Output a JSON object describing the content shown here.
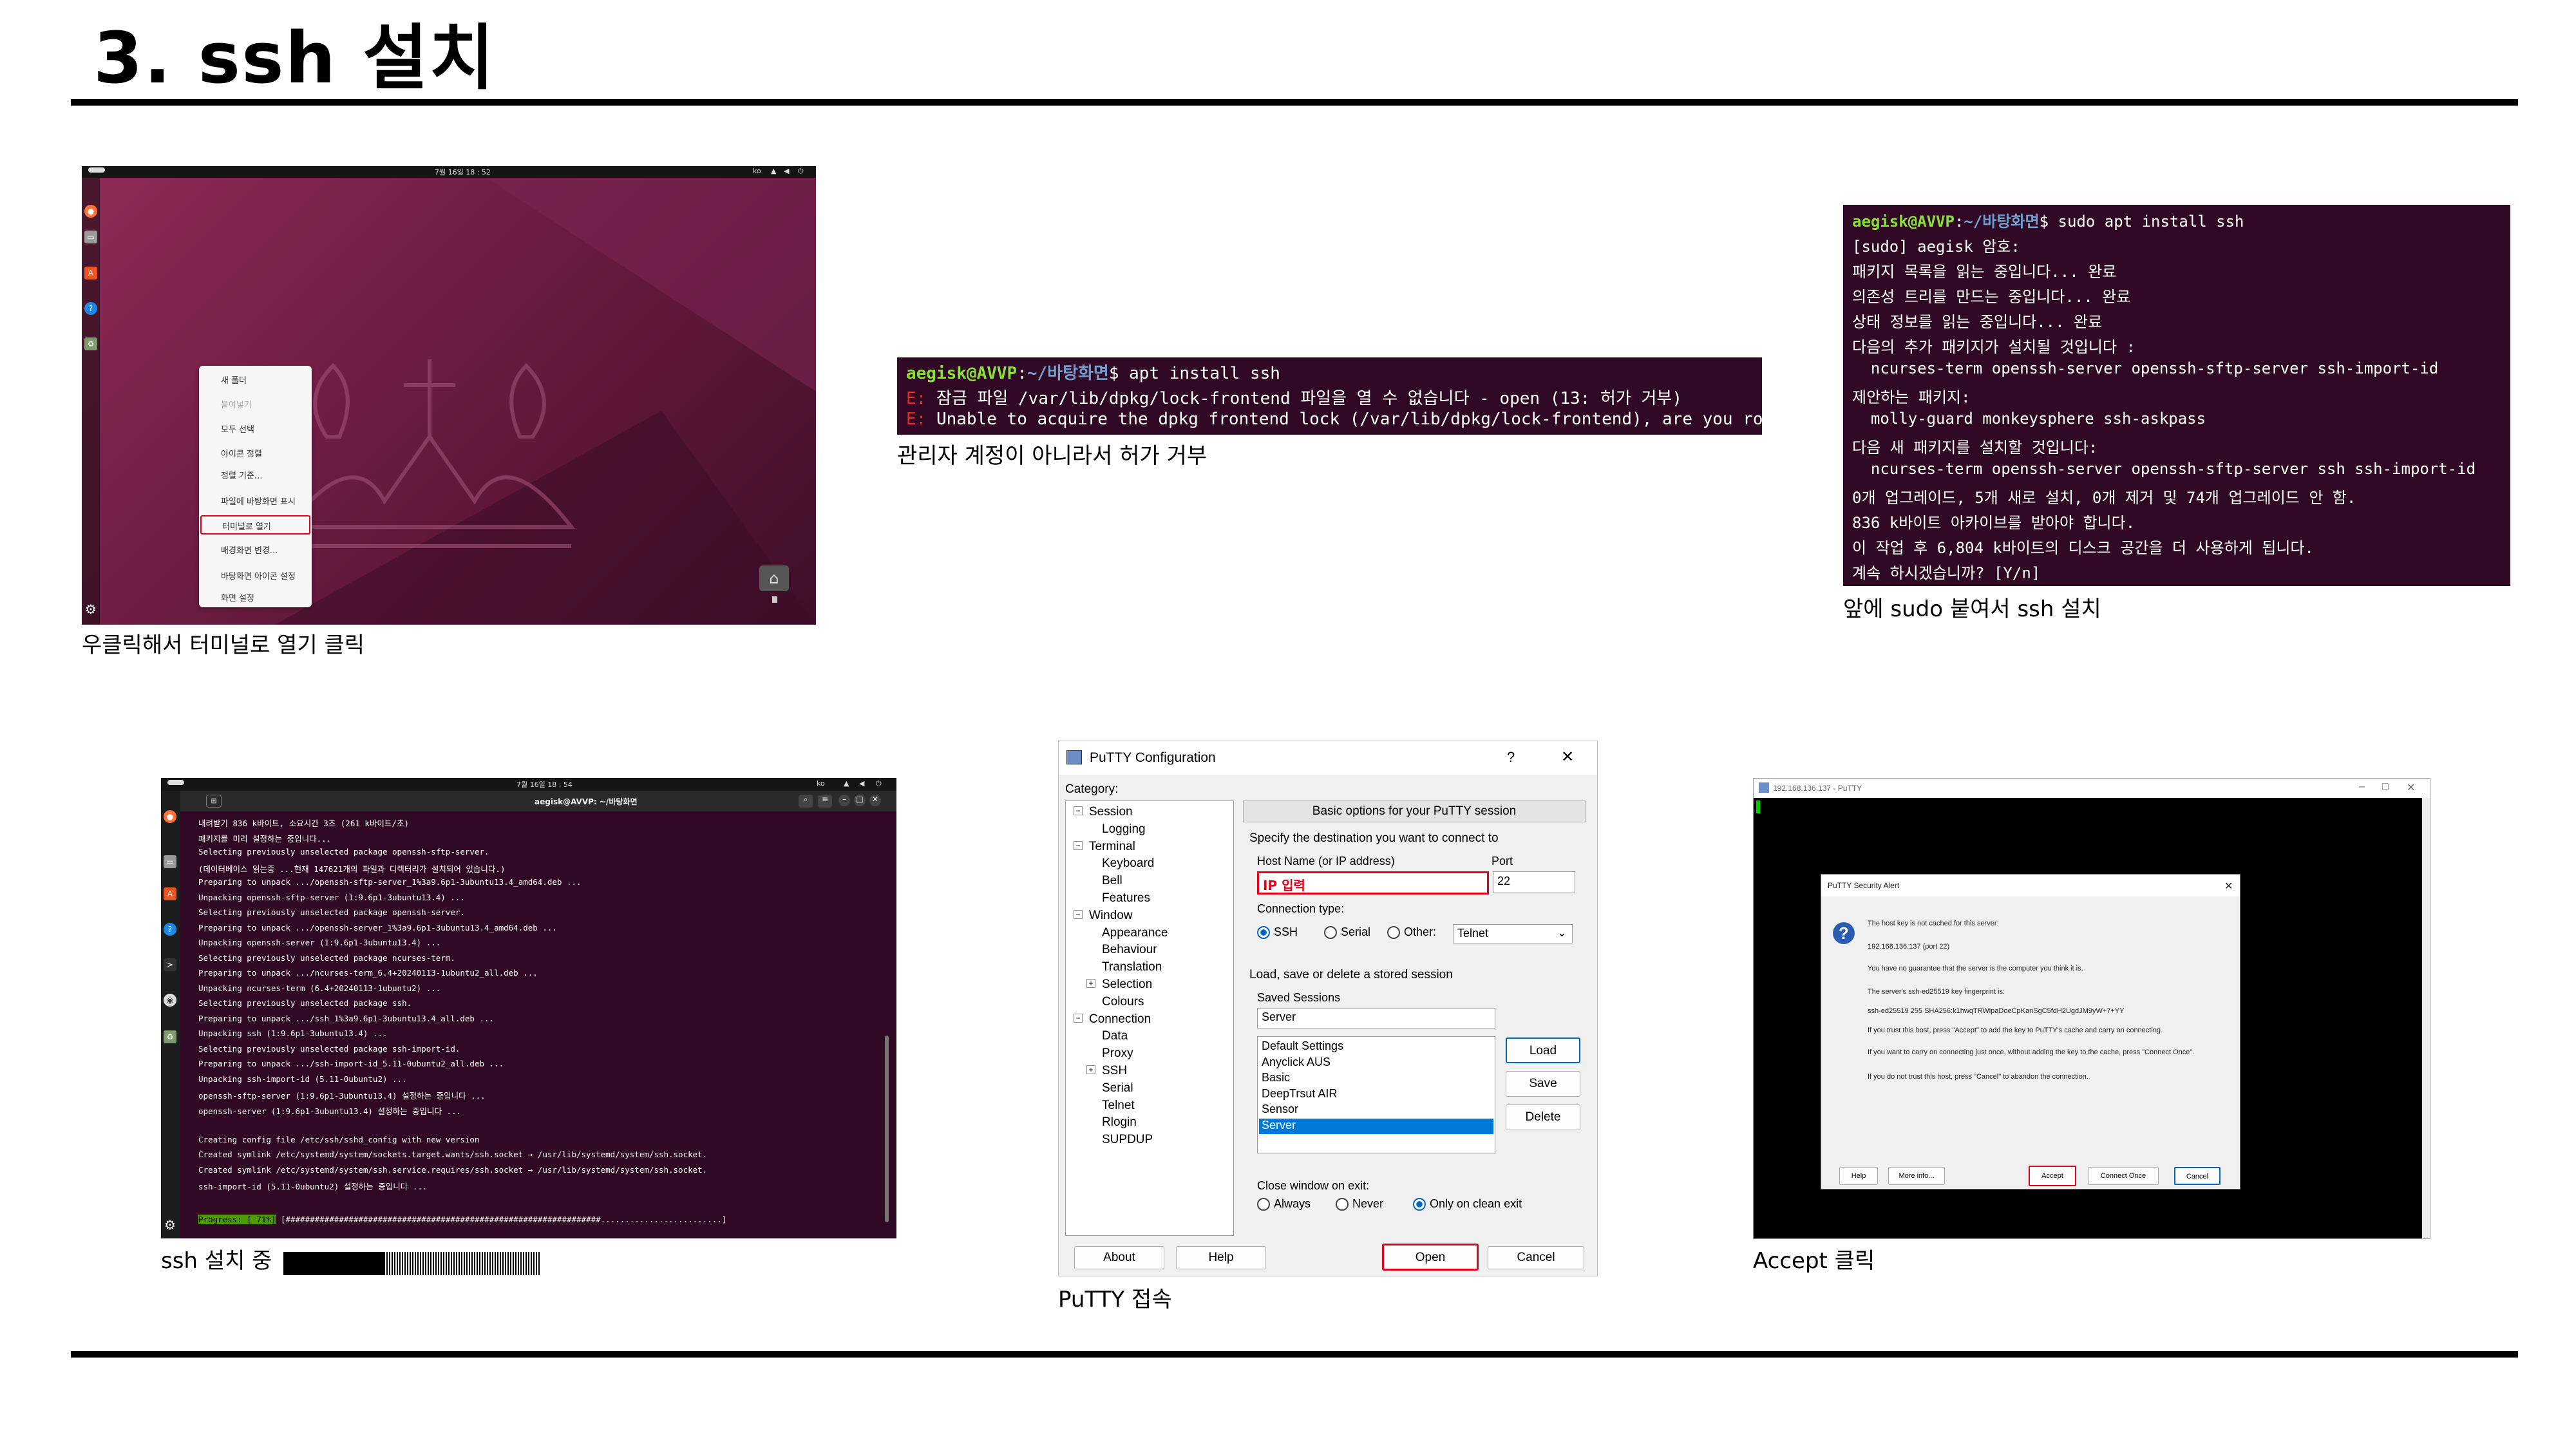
{
  "page": {
    "title": "3. ssh 설치"
  },
  "panel1": {
    "caption": "우클릭해서 터미널로 열기 클릭",
    "clock": "7월 16일 18 : 52",
    "lang": "ko",
    "menu": [
      "새 폴더",
      "붙여넣기",
      "모두 선택",
      "아이콘 정렬",
      "정렬 기준...",
      "파일에 바탕화면 표시",
      "터미널로 열기",
      "배경화면 변경...",
      "바탕화면 아이콘 설정",
      "화면 설정"
    ]
  },
  "panel2": {
    "caption": "관리자 계정이 아니라서 허가 거부",
    "prompt_user": "aegisk@AVVP",
    "prompt_path": "~/바탕화면",
    "command": "$ apt install ssh",
    "err_tag": "E:",
    "err1": "잠금 파일 /var/lib/dpkg/lock-frontend 파일을 열 수 없습니다 - open (13: 허가 거부)",
    "err2": "Unable to acquire the dpkg frontend lock (/var/lib/dpkg/lock-frontend), are you root?"
  },
  "panel3": {
    "caption": "앞에 sudo 붙여서 ssh 설치",
    "prompt_user": "aegisk@AVVP",
    "prompt_path": "~/바탕화면",
    "command": "$ sudo apt install ssh",
    "lines": [
      "[sudo] aegisk 암호:",
      "패키지 목록을 읽는 중입니다... 완료",
      "의존성 트리를 만드는 중입니다... 완료",
      "상태 정보를 읽는 중입니다... 완료",
      "다음의 추가 패키지가 설치될 것입니다 :",
      "  ncurses-term openssh-server openssh-sftp-server ssh-import-id",
      "제안하는 패키지:",
      "  molly-guard monkeysphere ssh-askpass",
      "다음 새 패키지를 설치할 것입니다:",
      "  ncurses-term openssh-server openssh-sftp-server ssh ssh-import-id",
      "0개 업그레이드, 5개 새로 설치, 0개 제거 및 74개 업그레이드 안 함.",
      "836 k바이트 아카이브를 받아야 합니다.",
      "이 작업 후 6,804 k바이트의 디스크 공간을 더 사용하게 됩니다.",
      "계속 하시겠습니까? [Y/n]"
    ]
  },
  "panel4": {
    "caption": "ssh 설치 중",
    "clock": "7월 16일 18 : 54",
    "lang": "ko",
    "window_title": "aegisk@AVVP: ~/바탕화면",
    "lines": [
      "내려받기 836 k바이트, 소요시간 3초 (261 k바이트/초)",
      "패키지를 미리 설정하는 중입니다...",
      "Selecting previously unselected package openssh-sftp-server.",
      "(데이터베이스 읽는중 ...현재 147621개의 파일과 디렉터리가 설치되어 있습니다.)",
      "Preparing to unpack .../openssh-sftp-server_1%3a9.6p1-3ubuntu13.4_amd64.deb ...",
      "Unpacking openssh-sftp-server (1:9.6p1-3ubuntu13.4) ...",
      "Selecting previously unselected package openssh-server.",
      "Preparing to unpack .../openssh-server_1%3a9.6p1-3ubuntu13.4_amd64.deb ...",
      "Unpacking openssh-server (1:9.6p1-3ubuntu13.4) ...",
      "Selecting previously unselected package ncurses-term.",
      "Preparing to unpack .../ncurses-term_6.4+20240113-1ubuntu2_all.deb ...",
      "Unpacking ncurses-term (6.4+20240113-1ubuntu2) ...",
      "Selecting previously unselected package ssh.",
      "Preparing to unpack .../ssh_1%3a9.6p1-3ubuntu13.4_all.deb ...",
      "Unpacking ssh (1:9.6p1-3ubuntu13.4) ...",
      "Selecting previously unselected package ssh-import-id.",
      "Preparing to unpack .../ssh-import-id_5.11-0ubuntu2_all.deb ...",
      "Unpacking ssh-import-id (5.11-0ubuntu2) ...",
      "openssh-sftp-server (1:9.6p1-3ubuntu13.4) 설정하는 중입니다 ...",
      "openssh-server (1:9.6p1-3ubuntu13.4) 설정하는 중입니다 ...",
      "",
      "Creating config file /etc/ssh/sshd_config with new version",
      "Created symlink /etc/systemd/system/sockets.target.wants/ssh.socket → /usr/lib/systemd/system/ssh.socket.",
      "Created symlink /etc/systemd/system/ssh.service.requires/ssh.socket → /usr/lib/systemd/system/ssh.socket.",
      "ssh-import-id (5.11-0ubuntu2) 설정하는 중입니다 ..."
    ],
    "progress_label": "Progress: [ 71%]",
    "progress_fraction": 0.71,
    "progress_bar": "[#################################################################.........................]"
  },
  "panel5": {
    "caption": "PuTTY 접속",
    "title": "PuTTY Configuration",
    "help_mark": "?",
    "close_mark": "✕",
    "category_label": "Category:",
    "tree": [
      {
        "label": "Session",
        "level": 0,
        "expander": "−"
      },
      {
        "label": "Logging",
        "level": 1
      },
      {
        "label": "Terminal",
        "level": 0,
        "expander": "−"
      },
      {
        "label": "Keyboard",
        "level": 1
      },
      {
        "label": "Bell",
        "level": 1
      },
      {
        "label": "Features",
        "level": 1
      },
      {
        "label": "Window",
        "level": 0,
        "expander": "−"
      },
      {
        "label": "Appearance",
        "level": 1
      },
      {
        "label": "Behaviour",
        "level": 1
      },
      {
        "label": "Translation",
        "level": 1
      },
      {
        "label": "Selection",
        "level": 1,
        "expander": "+"
      },
      {
        "label": "Colours",
        "level": 1
      },
      {
        "label": "Connection",
        "level": 0,
        "expander": "−"
      },
      {
        "label": "Data",
        "level": 1
      },
      {
        "label": "Proxy",
        "level": 1
      },
      {
        "label": "SSH",
        "level": 1,
        "expander": "+"
      },
      {
        "label": "Serial",
        "level": 1
      },
      {
        "label": "Telnet",
        "level": 1
      },
      {
        "label": "Rlogin",
        "level": 1
      },
      {
        "label": "SUPDUP",
        "level": 1
      }
    ],
    "section_header": "Basic options for your PuTTY session",
    "dest_label": "Specify the destination you want to connect to",
    "host_label": "Host Name (or IP address)",
    "host_value": "IP 입력",
    "port_label": "Port",
    "port_value": "22",
    "conn_type_label": "Connection type:",
    "conn_types": [
      "SSH",
      "Serial",
      "Other:"
    ],
    "other_value": "Telnet",
    "sessions_group": "Load, save or delete a stored session",
    "saved_label": "Saved Sessions",
    "saved_value": "Server",
    "sessions": [
      "Default Settings",
      "Anyclick AUS",
      "Basic",
      "DeepTrsut AIR",
      "Sensor",
      "Server"
    ],
    "load": "Load",
    "save": "Save",
    "delete": "Delete",
    "close_label": "Close window on exit:",
    "close_opts": [
      "Always",
      "Never",
      "Only on clean exit"
    ],
    "about": "About",
    "help": "Help",
    "open": "Open",
    "cancel": "Cancel"
  },
  "panel6": {
    "caption": "Accept 클릭",
    "window_title": "192.168.136.137 - PuTTY",
    "alert_title": "PuTTY Security Alert",
    "close_mark": "✕",
    "lines": [
      "The host key is not cached for this server:",
      "192.168.136.137 (port 22)",
      "You have no guarantee that the server is the computer you think it is.",
      "The server's ssh-ed25519 key fingerprint is:",
      "ssh-ed25519 255 SHA256:k1hwqTRWipaDoeCpKanSgC5fdH2UgdJM9yW+7+YY",
      "If you trust this host, press \"Accept\" to add the key to PuTTY's cache and carry on connecting.",
      "If you want to carry on connecting just once, without adding the key to the cache, press \"Connect Once\".",
      "If you do not trust this host, press \"Cancel\" to abandon the connection."
    ],
    "help": "Help",
    "more": "More info...",
    "accept": "Accept",
    "once": "Connect Once",
    "cancel": "Cancel"
  },
  "colors": {
    "terminal_bg": "#300a24",
    "prompt_green": "#8ae234",
    "prompt_blue": "#729fcf",
    "error_red": "#ef2929",
    "highlight_red": "#e0001b",
    "selection_blue": "#0078d7"
  }
}
